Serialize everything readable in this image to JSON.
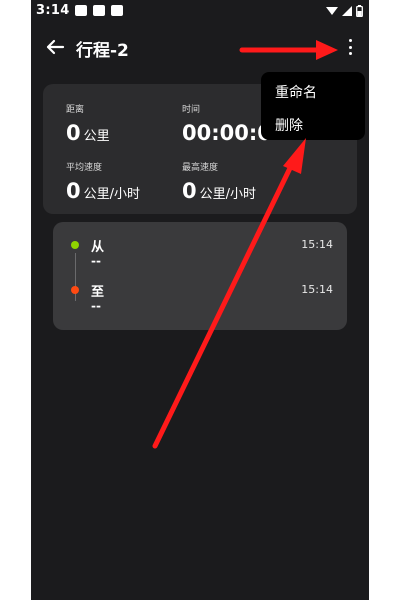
{
  "status_bar": {
    "time": "3:14"
  },
  "header": {
    "title": "行程-2"
  },
  "stats": {
    "distance": {
      "label": "距离",
      "value": "0",
      "unit": "公里"
    },
    "time": {
      "label": "时间",
      "value": "00:00:0"
    },
    "avg_speed": {
      "label": "平均速度",
      "value": "0",
      "unit": "公里/小时"
    },
    "max_speed": {
      "label": "最高速度",
      "value": "0",
      "unit": "公里/小时"
    }
  },
  "route": {
    "from": {
      "label": "从",
      "place": "--",
      "time": "15:14",
      "color": "#8fd400"
    },
    "to": {
      "label": "至",
      "place": "--",
      "time": "15:14",
      "color": "#ff4a12"
    }
  },
  "menu": {
    "items": [
      {
        "label": "重命名"
      },
      {
        "label": "删除"
      }
    ]
  },
  "colors": {
    "background": "#1b1b1d",
    "card": "#2c2c2e",
    "route_card": "#3a3a3c",
    "annotation_arrow": "#ff1a1a"
  },
  "icons": {
    "back": "arrow-left-icon",
    "more": "more-vertical-icon"
  }
}
